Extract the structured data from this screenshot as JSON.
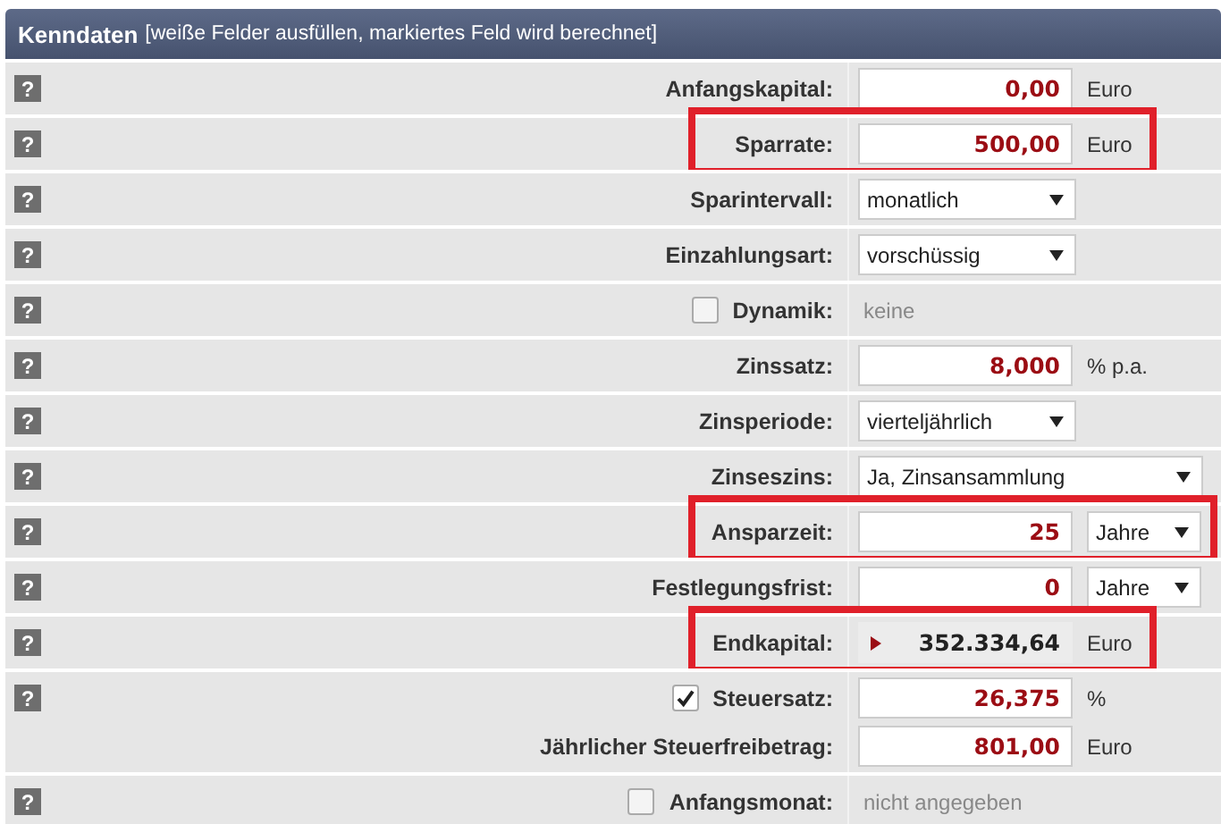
{
  "header": {
    "title": "Kenndaten",
    "subtitle": "[weiße Felder ausfüllen, markiertes Feld wird berechnet]"
  },
  "rows": [
    {
      "help": "?",
      "label": "Anfangskapital:",
      "kind": "input",
      "value": "0,00",
      "unit": "Euro",
      "highlighted": false
    },
    {
      "help": "?",
      "label": "Sparrate:",
      "kind": "input",
      "value": "500,00",
      "unit": "Euro",
      "highlighted": true
    },
    {
      "help": "?",
      "label": "Sparintervall:",
      "kind": "select",
      "value": "monatlich",
      "highlighted": false
    },
    {
      "help": "?",
      "label": "Einzahlungsart:",
      "kind": "select",
      "value": "vorschüssig",
      "highlighted": false
    },
    {
      "help": "?",
      "label": "Dynamik:",
      "checked": false,
      "kind": "text",
      "value": "keine",
      "highlighted": false
    },
    {
      "help": "?",
      "label": "Zinssatz:",
      "kind": "input",
      "value": "8,000",
      "unit": "% p.a.",
      "highlighted": false
    },
    {
      "help": "?",
      "label": "Zinsperiode:",
      "kind": "select",
      "value": "vierteljährlich",
      "highlighted": false
    },
    {
      "help": "?",
      "label": "Zinseszins:",
      "kind": "select-wide",
      "value": "Ja, Zinsansammlung",
      "highlighted": false
    },
    {
      "help": "?",
      "label": "Ansparzeit:",
      "kind": "input",
      "value": "25",
      "unit_select": "Jahre",
      "highlighted": true
    },
    {
      "help": "?",
      "label": "Festlegungsfrist:",
      "kind": "input",
      "value": "0",
      "unit_select": "Jahre",
      "highlighted": false
    },
    {
      "help": "?",
      "label": "Endkapital:",
      "kind": "output",
      "value": "352.334,64",
      "unit": "Euro",
      "highlighted": true
    },
    {
      "help": "?",
      "label": "Steuersatz:",
      "checked": true,
      "kind": "input",
      "value": "26,375",
      "unit": "%",
      "highlighted": false
    },
    {
      "label": "Jährlicher Steuerfreibetrag:",
      "kind": "input",
      "value": "801,00",
      "unit": "Euro",
      "highlighted": false
    },
    {
      "help": "?",
      "label": "Anfangsmonat:",
      "checked": false,
      "kind": "text",
      "value": "nicht angegeben",
      "highlighted": false
    }
  ]
}
